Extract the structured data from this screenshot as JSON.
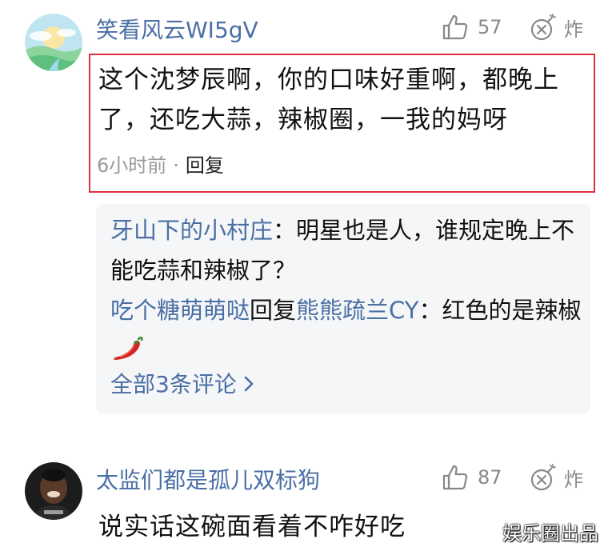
{
  "comment1": {
    "username": "笑看风云WI5gV",
    "likes": "57",
    "report_label": "炸",
    "text": "这个沈梦辰啊，你的口味好重啊，都晚上了，还吃大蒜，辣椒圈，一我的妈呀",
    "time": "6小时前",
    "separator": "·",
    "reply_label": "回复"
  },
  "replies": {
    "items": [
      {
        "author": "牙山下的小村庄",
        "connector": "",
        "target": "",
        "separator": "：",
        "text": "明星也是人，谁规定晚上不能吃蒜和辣椒了？"
      },
      {
        "author": "吃个糖萌萌哒",
        "connector": "回复",
        "target": "熊熊疏兰CY",
        "separator": "：",
        "text": "红色的是辣椒",
        "emoji": "chili-pepper-icon"
      }
    ],
    "view_all": "全部3条评论"
  },
  "comment2": {
    "username": "太监们都是孤儿双标狗",
    "likes": "87",
    "report_label": "炸",
    "text": "说实话这碗面看着不咋好吃"
  },
  "watermark": "娱乐圈出品",
  "colors": {
    "link_blue": "#4a6fa5",
    "highlight_red": "#e0323e",
    "panel_bg": "#f5f6f8",
    "meta_gray": "#999999"
  }
}
